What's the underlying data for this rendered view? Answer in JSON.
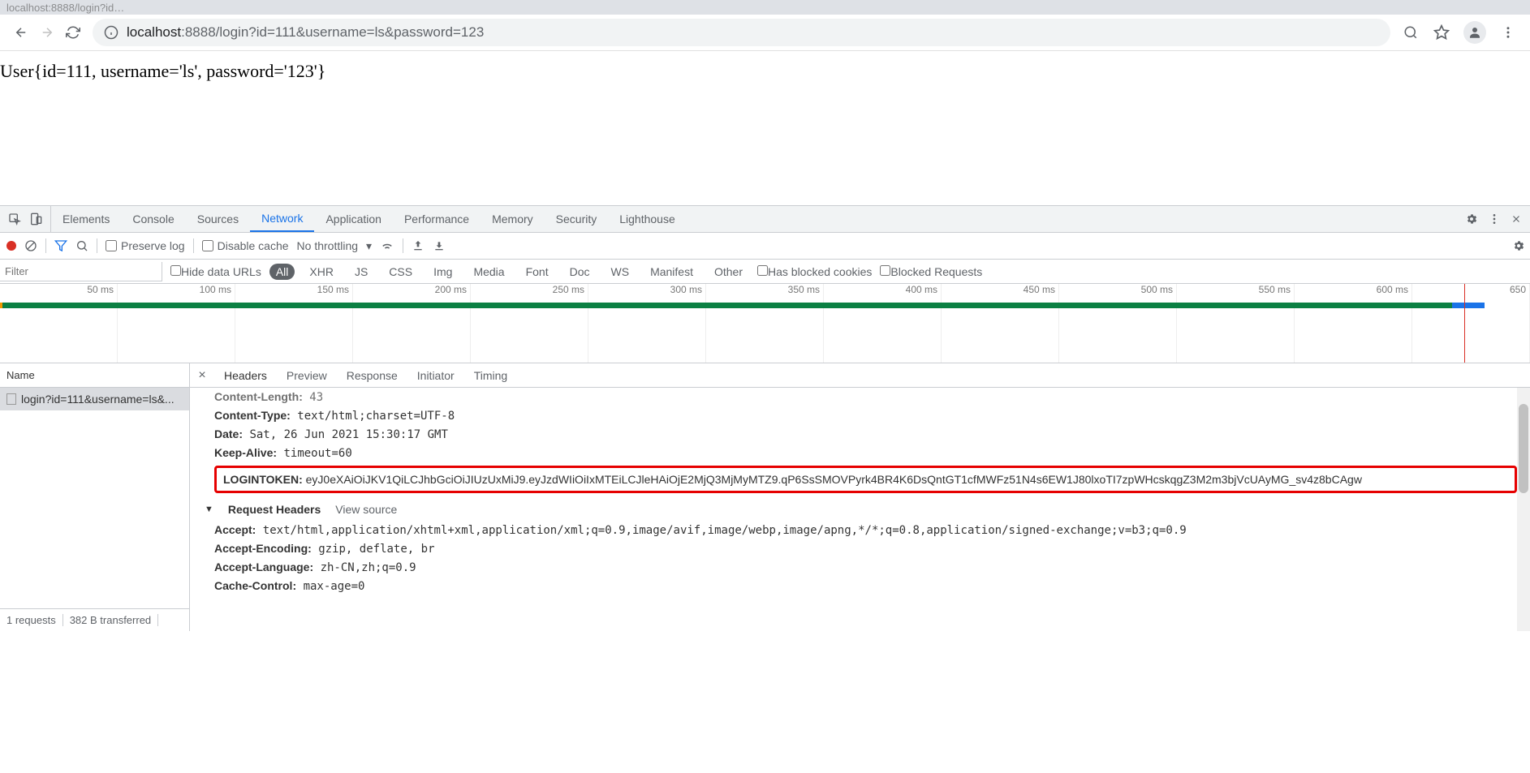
{
  "browser": {
    "tab_text": "localhost:8888/login?id…"
  },
  "toolbar": {
    "url_host": "localhost",
    "url_path": ":8888/login?id=111&username=ls&password=123"
  },
  "page": {
    "body_text": "User{id=111, username='ls', password='123'}"
  },
  "devtools": {
    "tabs": [
      "Elements",
      "Console",
      "Sources",
      "Network",
      "Application",
      "Performance",
      "Memory",
      "Security",
      "Lighthouse"
    ],
    "active_tab": "Network",
    "network_toolbar": {
      "preserve_log": "Preserve log",
      "disable_cache": "Disable cache",
      "throttling": "No throttling"
    },
    "filter": {
      "placeholder": "Filter",
      "hide_data_urls": "Hide data URLs",
      "types": [
        "All",
        "XHR",
        "JS",
        "CSS",
        "Img",
        "Media",
        "Font",
        "Doc",
        "WS",
        "Manifest",
        "Other"
      ],
      "has_blocked_cookies": "Has blocked cookies",
      "blocked_requests": "Blocked Requests"
    },
    "timeline_ticks": [
      "50 ms",
      "100 ms",
      "150 ms",
      "200 ms",
      "250 ms",
      "300 ms",
      "350 ms",
      "400 ms",
      "450 ms",
      "500 ms",
      "550 ms",
      "600 ms",
      "650"
    ],
    "request_list": {
      "header": "Name",
      "rows": [
        "login?id=111&username=ls&..."
      ],
      "footer_requests": "1 requests",
      "footer_transferred": "382 B transferred"
    },
    "detail_tabs": [
      "Headers",
      "Preview",
      "Response",
      "Initiator",
      "Timing"
    ],
    "headers": {
      "content_length_label": "Content-Length:",
      "content_length_value": "43",
      "content_type_label": "Content-Type:",
      "content_type_value": "text/html;charset=UTF-8",
      "date_label": "Date:",
      "date_value": "Sat, 26 Jun 2021 15:30:17 GMT",
      "keep_alive_label": "Keep-Alive:",
      "keep_alive_value": "timeout=60",
      "logintoken_label": "LOGINTOKEN:",
      "logintoken_value": "eyJ0eXAiOiJKV1QiLCJhbGciOiJIUzUxMiJ9.eyJzdWIiOiIxMTEiLCJleHAiOjE2MjQ3MjMyMTZ9.qP6SsSMOVPyrk4BR4K6DsQntGT1cfMWFz51N4s6EW1J80lxoTI7zpWHcskqgZ3M2m3bjVcUAyMG_sv4z8bCAgw",
      "request_headers_title": "Request Headers",
      "view_source": "View source",
      "accept_label": "Accept:",
      "accept_value": "text/html,application/xhtml+xml,application/xml;q=0.9,image/avif,image/webp,image/apng,*/*;q=0.8,application/signed-exchange;v=b3;q=0.9",
      "accept_encoding_label": "Accept-Encoding:",
      "accept_encoding_value": "gzip, deflate, br",
      "accept_language_label": "Accept-Language:",
      "accept_language_value": "zh-CN,zh;q=0.9",
      "cache_control_label": "Cache-Control:",
      "cache_control_value": "max-age=0"
    }
  }
}
